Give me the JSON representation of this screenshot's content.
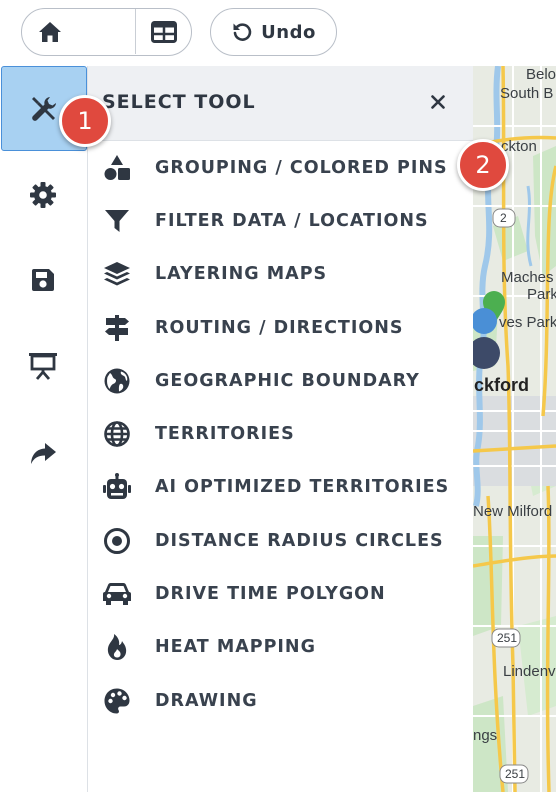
{
  "toolbar": {
    "views": [
      {
        "name": "home",
        "icon": "home-icon"
      },
      {
        "name": "map",
        "icon": "map-icon",
        "active": true
      },
      {
        "name": "table",
        "icon": "table-icon"
      }
    ],
    "undo_label": "Undo"
  },
  "rail": {
    "items": [
      {
        "icon": "tools-icon",
        "active": true
      },
      {
        "icon": "gear-icon"
      },
      {
        "icon": "save-icon"
      },
      {
        "icon": "presentation-icon"
      },
      {
        "icon": "share-icon"
      }
    ]
  },
  "panel": {
    "title": "SELECT TOOL",
    "close_glyph": "✕",
    "tools": [
      {
        "label": "GROUPING / COLORED PINS",
        "icon": "shapes-icon"
      },
      {
        "label": "FILTER DATA / LOCATIONS",
        "icon": "filter-icon"
      },
      {
        "label": "LAYERING MAPS",
        "icon": "layers-icon"
      },
      {
        "label": "ROUTING / DIRECTIONS",
        "icon": "signpost-icon"
      },
      {
        "label": "GEOGRAPHIC BOUNDARY",
        "icon": "globe-icon"
      },
      {
        "label": "TERRITORIES",
        "icon": "grid-globe-icon"
      },
      {
        "label": "AI OPTIMIZED TERRITORIES",
        "icon": "robot-icon"
      },
      {
        "label": "DISTANCE RADIUS CIRCLES",
        "icon": "radius-icon"
      },
      {
        "label": "DRIVE TIME POLYGON",
        "icon": "car-icon"
      },
      {
        "label": "HEAT MAPPING",
        "icon": "flame-icon"
      },
      {
        "label": "DRAWING",
        "icon": "palette-icon"
      }
    ]
  },
  "map": {
    "labels": [
      "Belo",
      "South B",
      "ckton",
      "Maches",
      "Park",
      "ves Park",
      "ckford",
      "New Milford",
      "Lindenv",
      "ngs"
    ],
    "road_shields": [
      "2",
      "251",
      "251"
    ]
  },
  "badges": [
    "1",
    "2"
  ],
  "colors": {
    "accent": "#a8d1f2",
    "accent_border": "#4a90d9",
    "badge": "#e0493e",
    "pin_green": "#4caf50",
    "pin_blue": "#4a8fd6",
    "pin_navy": "#3d4a68"
  }
}
